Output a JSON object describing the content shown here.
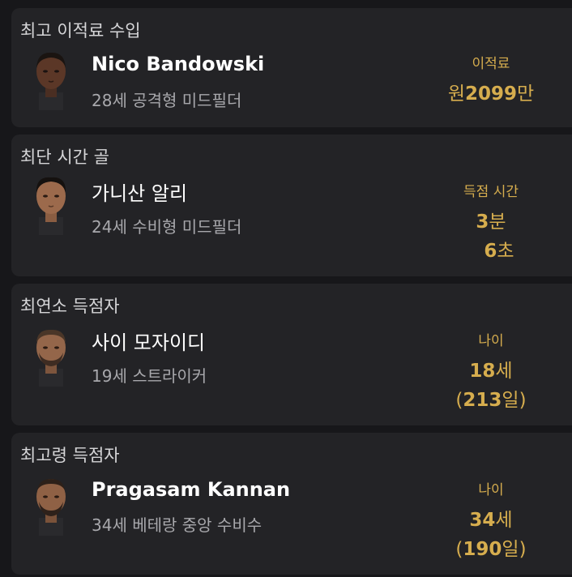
{
  "records": [
    {
      "title": "최고 이적료 수입",
      "player_name": "Nico Bandowski",
      "player_desc": "28세 공격형 미드필더",
      "stat_label": "이적료",
      "value1_prefix": "원",
      "value1_num": "2099",
      "value1_suffix": "만"
    },
    {
      "title": "최단 시간 골",
      "player_name": "가니산 알리",
      "player_desc": "24세 수비형 미드필더",
      "stat_label": "득점 시간",
      "value1_num": "3",
      "value1_suffix": "분",
      "value2_num": "6",
      "value2_suffix": "초"
    },
    {
      "title": "최연소 득점자",
      "player_name": "사이 모자이디",
      "player_desc": "19세 스트라이커",
      "stat_label": "나이",
      "value1_num": "18",
      "value1_suffix": "세",
      "value2_prefix": "(",
      "value2_num": "213",
      "value2_suffix": "일)"
    },
    {
      "title": "최고령 득점자",
      "player_name": "Pragasam Kannan",
      "player_desc": "34세 베테랑 중앙 수비수",
      "stat_label": "나이",
      "value1_num": "34",
      "value1_suffix": "세",
      "value2_prefix": "(",
      "value2_num": "190",
      "value2_suffix": "일)"
    }
  ],
  "colors": {
    "background": "#17171a",
    "card": "#232326",
    "accent": "#d6ad4e",
    "name": "#ffffff",
    "secondary": "#a8a8ac"
  },
  "icons": [
    "player-face-icon"
  ]
}
